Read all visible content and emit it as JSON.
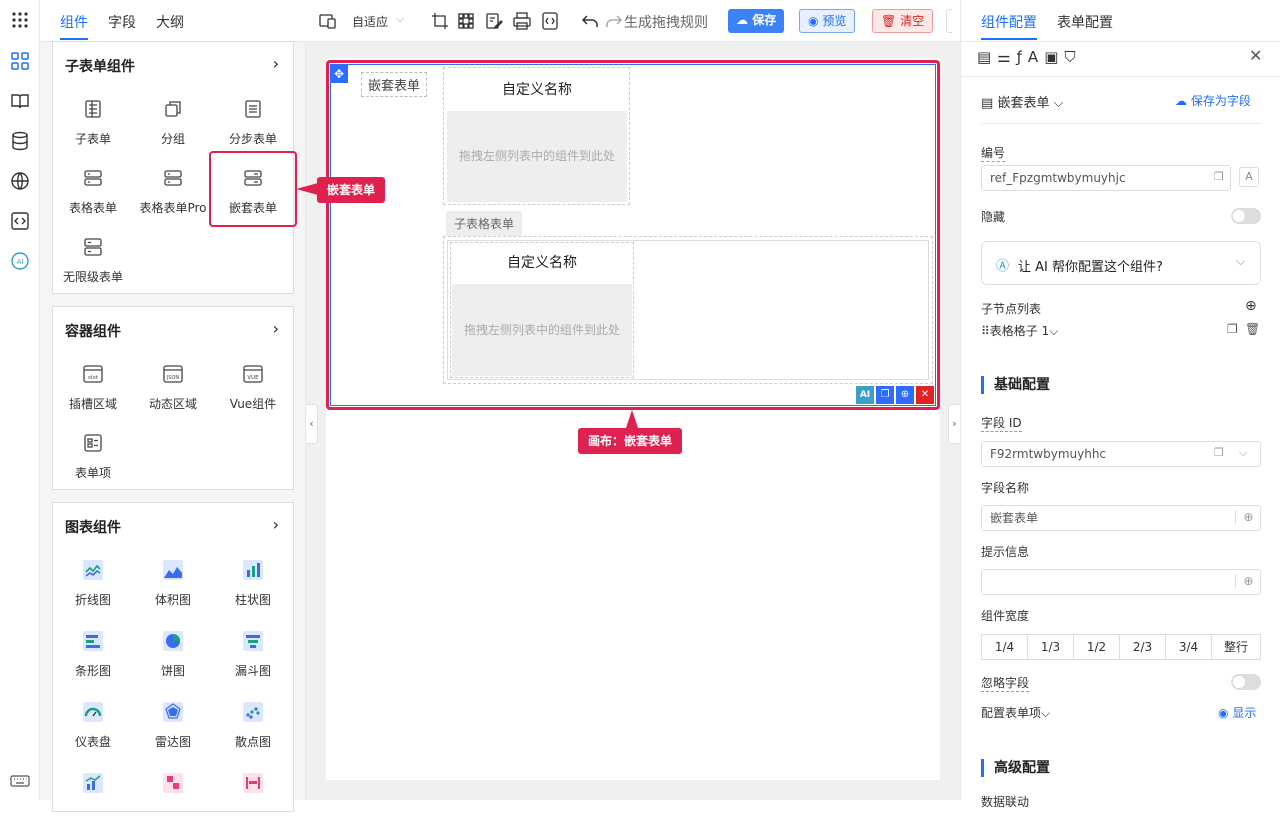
{
  "left_tabs": [
    "组件",
    "字段",
    "大纲"
  ],
  "card_sub": {
    "title": "子表单组件",
    "items": [
      {
        "label": "子表单",
        "icon": "subform-icon"
      },
      {
        "label": "分组",
        "icon": "group-icon"
      },
      {
        "label": "分步表单",
        "icon": "step-form-icon"
      },
      {
        "label": "表格表单",
        "icon": "table-form-icon"
      },
      {
        "label": "表格表单Pro",
        "icon": "table-form-pro-icon"
      },
      {
        "label": "嵌套表单",
        "icon": "nested-form-icon"
      },
      {
        "label": "无限级表单",
        "icon": "infinite-form-icon"
      }
    ]
  },
  "card_container": {
    "title": "容器组件",
    "items": [
      {
        "label": "插槽区域",
        "icon": "slot-icon",
        "tag": "slot"
      },
      {
        "label": "动态区域",
        "icon": "json-icon",
        "tag": "JSON"
      },
      {
        "label": "Vue组件",
        "icon": "vue-icon",
        "tag": "VUE"
      },
      {
        "label": "表单项",
        "icon": "form-item-icon",
        "tag": ""
      }
    ]
  },
  "card_chart": {
    "title": "图表组件",
    "items": [
      {
        "label": "折线图",
        "icon": "line-chart-icon"
      },
      {
        "label": "体积图",
        "icon": "area-chart-icon"
      },
      {
        "label": "柱状图",
        "icon": "bar-chart-icon"
      },
      {
        "label": "条形图",
        "icon": "hbar-chart-icon"
      },
      {
        "label": "饼图",
        "icon": "pie-chart-icon"
      },
      {
        "label": "漏斗图",
        "icon": "funnel-chart-icon"
      },
      {
        "label": "仪表盘",
        "icon": "gauge-chart-icon"
      },
      {
        "label": "雷达图",
        "icon": "radar-chart-icon"
      },
      {
        "label": "散点图",
        "icon": "scatter-chart-icon"
      }
    ]
  },
  "toolbar": {
    "layout_mode": "自适应",
    "generate_rule": "生成拖拽规则",
    "save": "保存",
    "preview": "预览",
    "clear": "清空"
  },
  "canvas": {
    "nested_label": "嵌套表单",
    "custom_name_1": "自定义名称",
    "drop_hint_1": "拖拽左侧列表中的组件到此处",
    "subtable_tag": "子表格表单",
    "custom_name_2": "自定义名称",
    "drop_hint_2": "拖拽左侧列表中的组件到此处",
    "ai_btn": "AI"
  },
  "callouts": {
    "left": "嵌套表单",
    "bottom": "画布：嵌套表单"
  },
  "right": {
    "tabs": [
      "组件配置",
      "表单配置"
    ],
    "component_type": "嵌套表单",
    "save_as_field": "保存为字段",
    "id_label": "编号",
    "id_value": "ref_Fpzgmtwbymuyhjc",
    "hidden_label": "隐藏",
    "ai_prompt": "让 AI 帮你配置这个组件?",
    "children_label": "子节点列表",
    "child_item": "表格格子 1",
    "basic_section": "基础配置",
    "field_id_label": "字段 ID",
    "field_id_value": "F92rmtwbymuyhhc",
    "field_name_label": "字段名称",
    "field_name_value": "嵌套表单",
    "tip_label": "提示信息",
    "tip_value": "",
    "width_label": "组件宽度",
    "widths": [
      "1/4",
      "1/3",
      "1/2",
      "2/3",
      "3/4",
      "整行"
    ],
    "ignore_label": "忽略字段",
    "config_item_label": "配置表单项",
    "show_label": "显示",
    "advanced_section": "高级配置",
    "data_link_label": "数据联动"
  },
  "colors": {
    "accent": "#1e6fff",
    "callout": "#e0214f",
    "save": "#3b82f6"
  }
}
